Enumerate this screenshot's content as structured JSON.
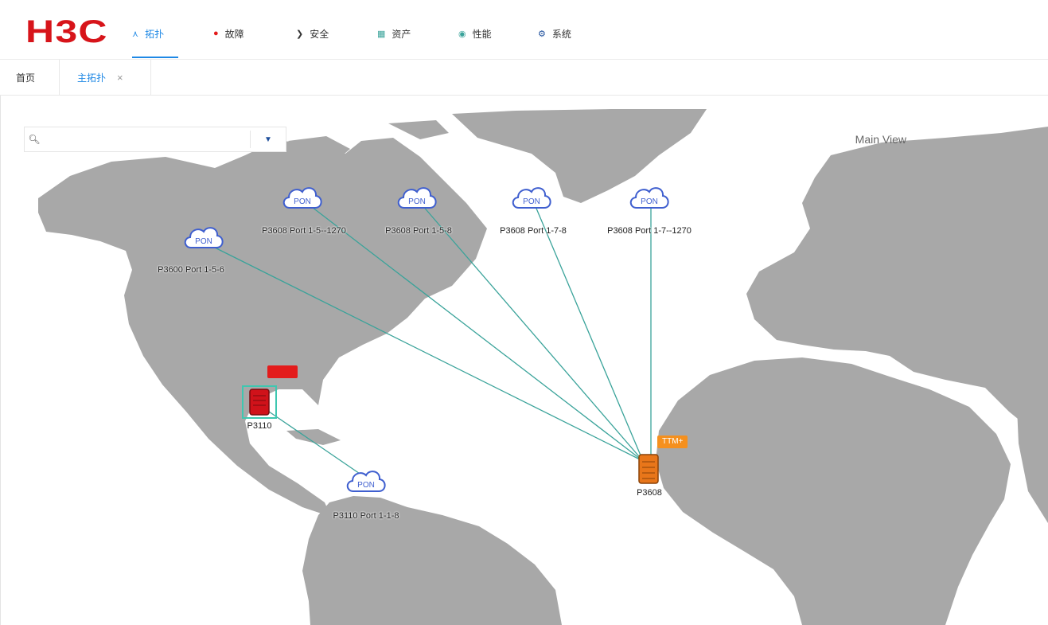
{
  "brand": {
    "logo_text": "H3C",
    "logo_color": "#d7141a"
  },
  "nav": {
    "items": [
      {
        "label": "拓扑",
        "icon": "topology-icon",
        "active": true
      },
      {
        "label": "故障",
        "icon": "fault-icon"
      },
      {
        "label": "安全",
        "icon": "security-icon"
      },
      {
        "label": "资产",
        "icon": "asset-icon"
      },
      {
        "label": "性能",
        "icon": "performance-icon"
      },
      {
        "label": "系统",
        "icon": "system-gear-icon"
      }
    ],
    "accent": "#1e88e5"
  },
  "tabs": {
    "home": "首页",
    "topology": "主拓扑",
    "close": "×"
  },
  "map": {
    "search": {
      "value": "",
      "placeholder": ""
    },
    "view_name": "Main View",
    "land_color": "#a8a8a8",
    "link_color": "#3aa39a",
    "nodes": {
      "pon_1": {
        "icon_text": "PON",
        "label": "P3600 Port 1-5-6"
      },
      "pon_2": {
        "icon_text": "PON",
        "label": "P3608 Port 1-5--1270"
      },
      "pon_3": {
        "icon_text": "PON",
        "label": "P3608 Port 1-5-8"
      },
      "pon_4": {
        "icon_text": "PON",
        "label": "P3608 Port 1-7-8"
      },
      "pon_5": {
        "icon_text": "PON",
        "label": "P3608 Port 1-7--1270"
      },
      "pon_6": {
        "icon_text": "PON",
        "label": "P3110 Port 1-1-8"
      },
      "device_1": {
        "label": "P3110",
        "alarm": "",
        "alarm_color": "#e31b1b"
      },
      "device_2": {
        "label": "P3608",
        "alarm": "TTM+",
        "alarm_color": "#f5901e"
      }
    }
  }
}
